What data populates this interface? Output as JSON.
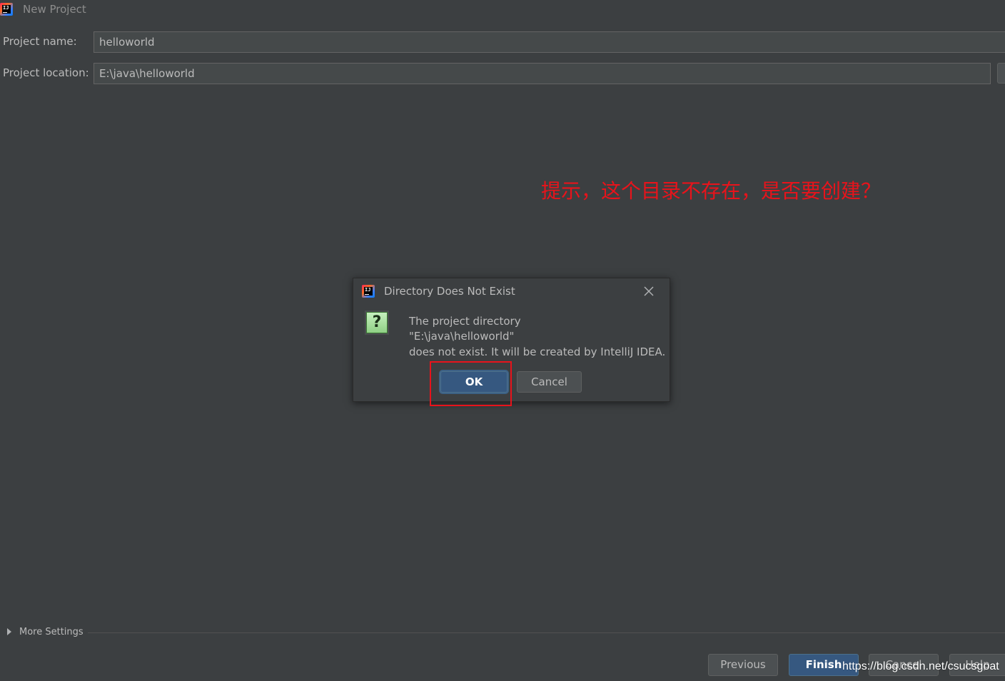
{
  "window": {
    "title": "New Project",
    "icon": "intellij-idea-icon"
  },
  "form": {
    "project_name_label": "Project name:",
    "project_name_value": "helloworld",
    "project_location_label": "Project location:",
    "project_location_value": "E:\\java\\helloworld"
  },
  "annotation": {
    "text": "提示，这个目录不存在，是否要创建？",
    "color": "#e8131b"
  },
  "dialog": {
    "title": "Directory Does Not Exist",
    "icon": "question-icon",
    "question_glyph": "?",
    "message_line1": "The project directory",
    "message_line2": "\"E:\\java\\helloworld\"",
    "message_line3": "does not exist. It will be created by IntelliJ IDEA.",
    "ok_label": "OK",
    "cancel_label": "Cancel"
  },
  "footer": {
    "more_settings_label": "More Settings",
    "previous_label": "Previous",
    "finish_label": "Finish",
    "cancel_label": "Cancel",
    "help_label": "Help"
  },
  "watermark": "https://blog.csdn.net/csucsgoat",
  "colors": {
    "background": "#3c3f41",
    "primary_button": "#365880",
    "highlight": "#e8131b"
  }
}
